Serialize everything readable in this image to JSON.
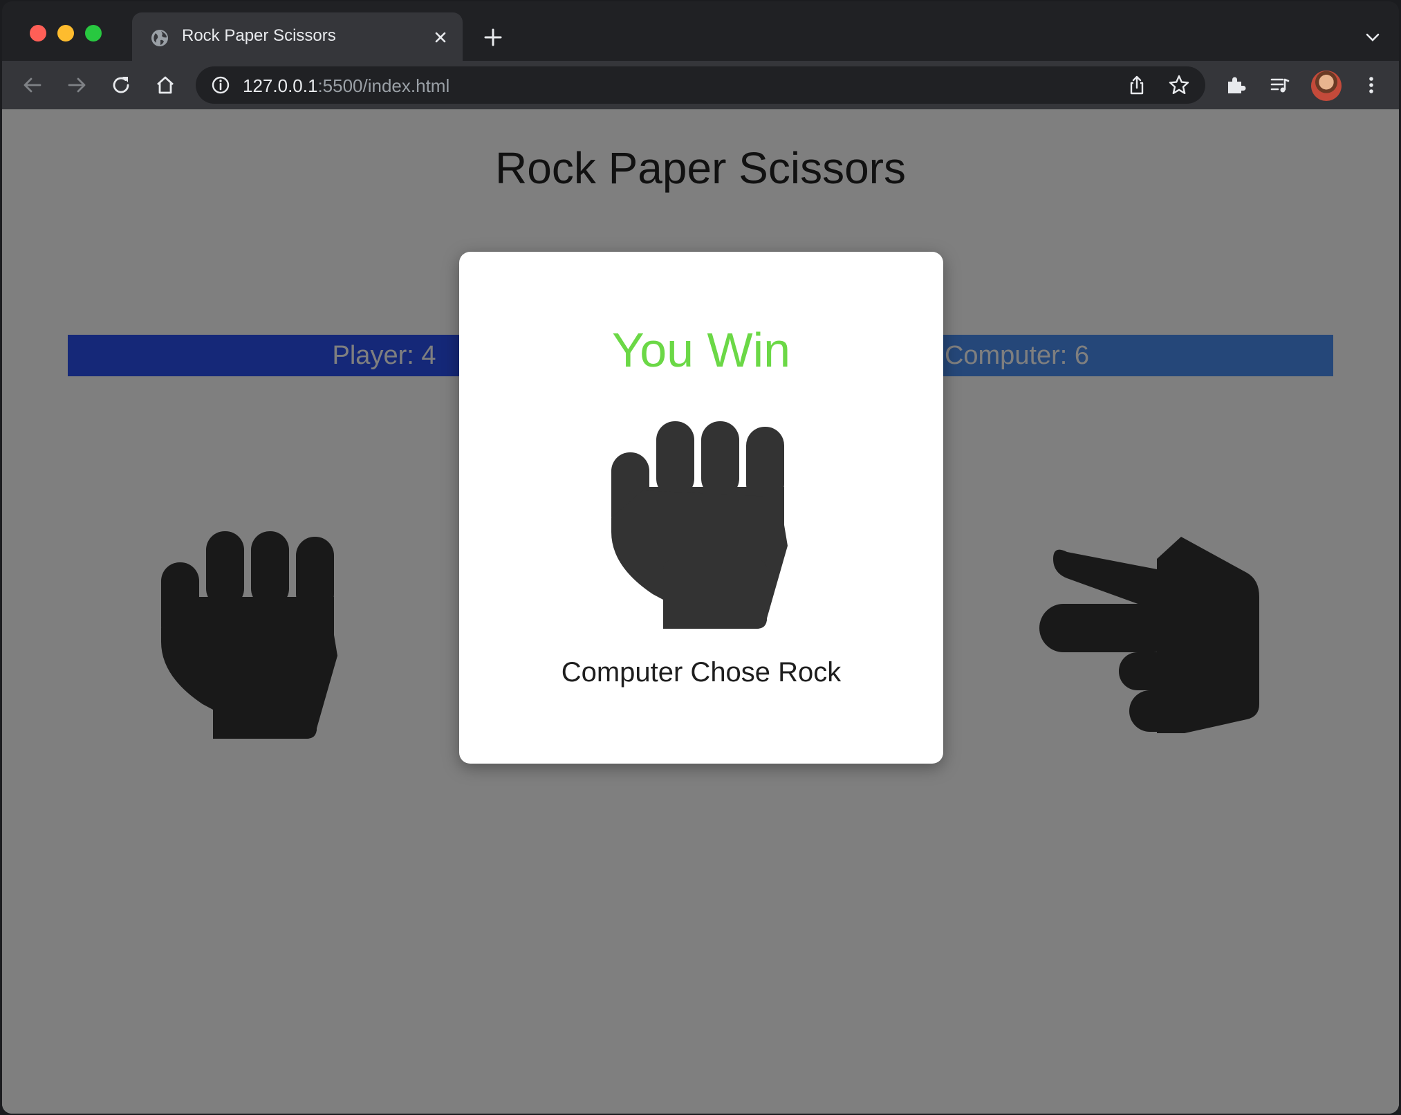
{
  "browser": {
    "tab": {
      "title": "Rock Paper Scissors",
      "favicon": "globe-icon"
    },
    "url": {
      "host": "127.0.0.1",
      "rest": ":5500/index.html"
    }
  },
  "page": {
    "title": "Rock Paper Scissors",
    "player_score": "Player: 4",
    "computer_score": "Computer: 6",
    "choices": [
      "rock-icon",
      "scissors-icon"
    ]
  },
  "modal": {
    "result": "You Win",
    "result_color": "#6bd846",
    "computer_choice_text": "Computer Chose Rock",
    "computer_choice_icon": "rock-icon"
  },
  "colors": {
    "player_bar": "#2a50f0",
    "computer_bar": "#4a8ef2"
  }
}
